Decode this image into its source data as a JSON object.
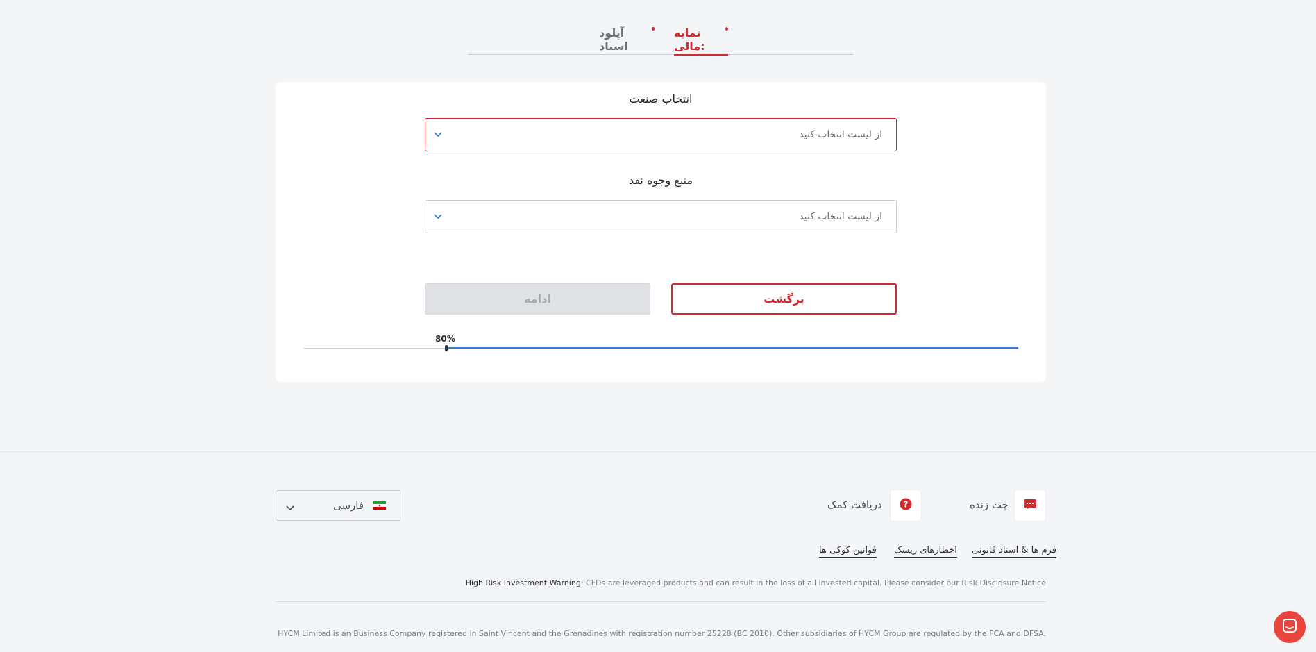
{
  "tabs": [
    {
      "label": "نمایه مالی:",
      "active": true,
      "required": true
    },
    {
      "label": "آپلود اسناد",
      "active": false,
      "required": true
    }
  ],
  "form": {
    "industry": {
      "label": "انتخاب صنعت",
      "value": "از لیست انتخاب کنید",
      "error": true
    },
    "funds_source": {
      "label": "منبع وجوه نقد",
      "value": "از لیست انتخاب کنید",
      "error": false
    }
  },
  "buttons": {
    "back": "برگشت",
    "continue": "ادامه"
  },
  "progress": {
    "label": "80%",
    "value": 0.8
  },
  "footer": {
    "live_chat": "چت زنده",
    "get_help": "دریافت کمک",
    "language": "فارسی",
    "links": [
      "فرم ها & اسناد قانونی",
      "اخطارهای ریسک",
      "قوانین کوکی ها"
    ],
    "warning_title": "High Risk Investment Warning:",
    "warning_text": " CFDs are leveraged products and can result in the loss of all invested capital. Please consider our Risk Disclosure Notice",
    "company_text": "HYCM Limited is an Business Company registered in Saint Vincent and the Grenadines with registration number 25228 (BC 2010). Other subsidiaries of HYCM Group are regulated by the FCA and DFSA."
  },
  "colors": {
    "accent": "#d12a2f",
    "progress": "#2f7cd6",
    "chat": "#e8453f"
  },
  "icons": [
    "chevron-down-icon",
    "help-icon",
    "chat-icon",
    "iran-flag-icon",
    "messenger-icon"
  ]
}
